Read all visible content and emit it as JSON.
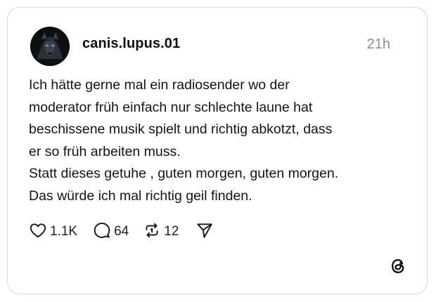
{
  "post": {
    "username": "canis.lupus.01",
    "timestamp": "21h",
    "text_lines": [
      "Ich hätte gerne mal ein radiosender wo der",
      "moderator früh einfach nur schlechte laune hat",
      "beschissene musik spielt und richtig abkotzt, dass",
      "er so früh arbeiten muss.",
      "Statt dieses getuhe , guten morgen, guten morgen.",
      "Das würde ich mal richtig geil finden."
    ],
    "actions": {
      "likes": "1.1K",
      "replies": "64",
      "reposts": "12"
    },
    "icons": {
      "avatar": "wolf-avatar",
      "like": "heart-icon",
      "reply": "comment-bubble-icon",
      "repost": "repost-icon",
      "share": "send-icon",
      "brand": "threads-logo-icon"
    },
    "colors": {
      "border": "#d9d9d9",
      "text": "#141414",
      "muted": "#8e8e8e"
    }
  }
}
